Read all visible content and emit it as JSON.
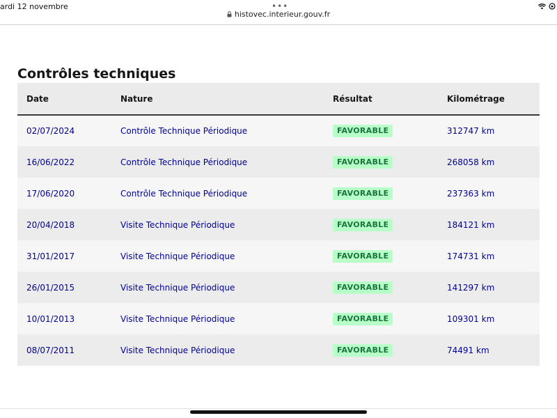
{
  "statusbar": {
    "date": "ardi 12 novembre",
    "right": "8"
  },
  "browser": {
    "url": "histovec.interieur.gouv.fr",
    "menu_dots": "•••"
  },
  "section": {
    "title": "Contrôles techniques"
  },
  "table": {
    "headers": [
      "Date",
      "Nature",
      "Résultat",
      "Kilométrage"
    ],
    "rows": [
      {
        "date": "02/07/2024",
        "nature": "Contrôle Technique Périodique",
        "result": "FAVORABLE",
        "km": "312747 km"
      },
      {
        "date": "16/06/2022",
        "nature": "Contrôle Technique Périodique",
        "result": "FAVORABLE",
        "km": "268058 km"
      },
      {
        "date": "17/06/2020",
        "nature": "Contrôle Technique Périodique",
        "result": "FAVORABLE",
        "km": "237363 km"
      },
      {
        "date": "20/04/2018",
        "nature": "Visite Technique Périodique",
        "result": "FAVORABLE",
        "km": "184121 km"
      },
      {
        "date": "31/01/2017",
        "nature": "Visite Technique Périodique",
        "result": "FAVORABLE",
        "km": "174731 km"
      },
      {
        "date": "26/01/2015",
        "nature": "Visite Technique Périodique",
        "result": "FAVORABLE",
        "km": "141297 km"
      },
      {
        "date": "10/01/2013",
        "nature": "Visite Technique Périodique",
        "result": "FAVORABLE",
        "km": "109301 km"
      },
      {
        "date": "08/07/2011",
        "nature": "Visite Technique Périodique",
        "result": "FAVORABLE",
        "km": "74491 km"
      }
    ]
  },
  "colors": {
    "link_blue": "#000091",
    "badge_bg": "#b8fec9",
    "badge_text": "#18753c"
  }
}
